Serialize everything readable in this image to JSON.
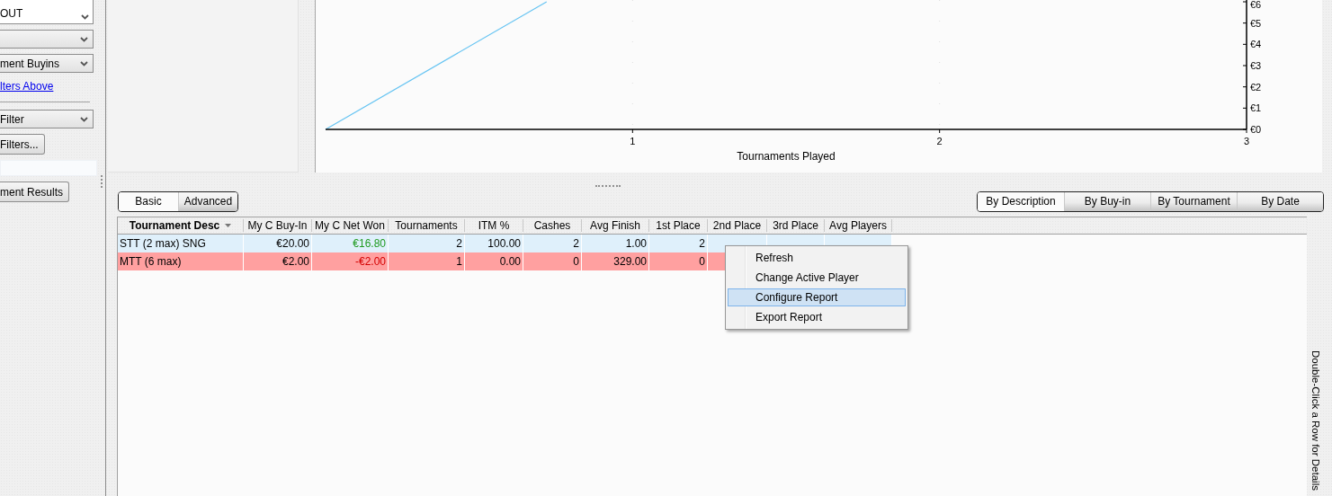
{
  "sidebar": {
    "items": [
      {
        "kind": "listbox",
        "text": "OUT"
      },
      {
        "kind": "dropdown"
      },
      {
        "kind": "dropdown",
        "text": "ment Buyins"
      },
      {
        "kind": "link",
        "text": "lters Above"
      },
      {
        "kind": "divider"
      },
      {
        "kind": "dropdown",
        "text": "Filter"
      },
      {
        "kind": "button",
        "text": "Filters..."
      },
      {
        "kind": "field"
      },
      {
        "kind": "button",
        "text": "ment Results"
      }
    ]
  },
  "chart": {
    "chart_data": {
      "type": "line",
      "xlabel": "Tournaments Played",
      "x": [
        0,
        0.72
      ],
      "series": [
        {
          "color": "#66c4f2",
          "values": [
            0,
            6
          ]
        }
      ],
      "xlim": [
        0,
        3
      ],
      "ylim": [
        0,
        6
      ],
      "xticks": [
        1,
        2,
        3
      ],
      "yticks": [
        {
          "value": 0,
          "label": "€0"
        },
        {
          "value": 1,
          "label": "€1"
        },
        {
          "value": 2,
          "label": "€2"
        },
        {
          "value": 3,
          "label": "€3"
        },
        {
          "value": 4,
          "label": "€4"
        },
        {
          "value": 5,
          "label": "€5"
        },
        {
          "value": 6,
          "label": "€6"
        }
      ]
    }
  },
  "mode_tabs": [
    {
      "label": "Basic",
      "selected": true
    },
    {
      "label": "Advanced",
      "selected": false
    }
  ],
  "group_tabs": [
    {
      "label": "By Description",
      "selected": true
    },
    {
      "label": "By Buy-in",
      "selected": false
    },
    {
      "label": "By Tournament",
      "selected": false
    },
    {
      "label": "By Date",
      "selected": false
    }
  ],
  "table": {
    "columns": [
      "Tournament Desc",
      "My C Buy-In",
      "My C Net Won",
      "Tournaments",
      "ITM %",
      "Cashes",
      "Avg Finish",
      "1st Place",
      "2nd Place",
      "3rd Place",
      "Avg Players"
    ],
    "rows": [
      {
        "color": "#dff0fb",
        "cells": [
          "STT (2 max) SNG",
          "€20.00",
          {
            "text": "€16.80",
            "color": "#1f9a1f"
          },
          "2",
          "100.00",
          "2",
          "1.00",
          "2"
        ]
      },
      {
        "color": "#ffa0a0",
        "cells": [
          "MTT (6 max)",
          "€2.00",
          {
            "text": "-€2.00",
            "color": "#d40000"
          },
          "1",
          "0.00",
          "0",
          "329.00",
          "0"
        ]
      }
    ]
  },
  "context_menu": {
    "items": [
      {
        "label": "Refresh",
        "selected": false
      },
      {
        "label": "Change Active Player",
        "selected": false
      },
      {
        "label": "Configure Report",
        "selected": true
      },
      {
        "label": "Export Report",
        "selected": false
      }
    ]
  },
  "hint": "Double-Click a Row for Details"
}
